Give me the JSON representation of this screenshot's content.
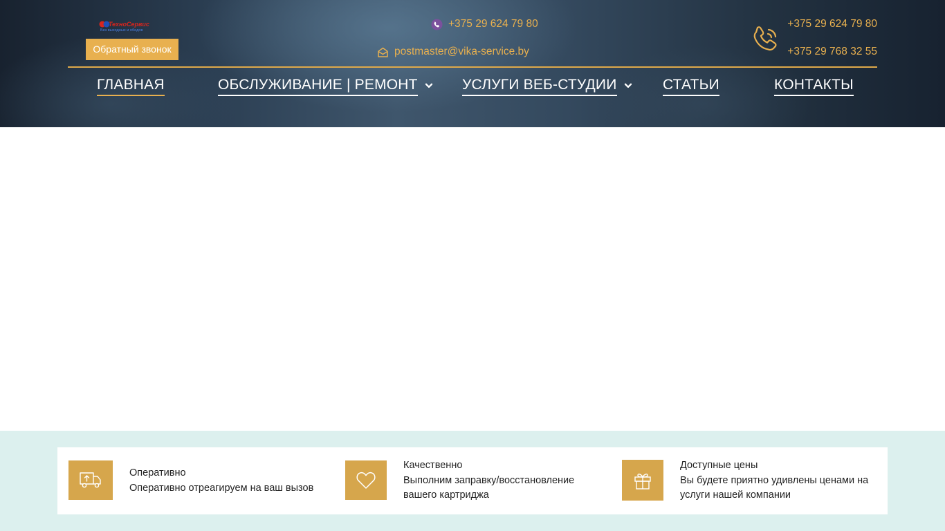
{
  "header": {
    "logo": {
      "text": "ТехноСервис",
      "tagline": "Без выходных и обедов",
      "icon": "logo-icon"
    },
    "callback_button": "Обратный звонок",
    "viber_phone": "+375 29 624 79 80",
    "email": "postmaster@vika-service.by",
    "phones_right": [
      "+375 29 624 79 80",
      "+375 29 768 32 55"
    ],
    "accent_color": "#e8b04f"
  },
  "nav": {
    "items": [
      {
        "label": "ГЛАВНАЯ",
        "active": true,
        "has_dropdown": false
      },
      {
        "label": "ОБСЛУЖИВАНИЕ | РЕМОНТ",
        "active": false,
        "has_dropdown": true
      },
      {
        "label": "УСЛУГИ ВЕБ-СТУДИИ",
        "active": false,
        "has_dropdown": true
      },
      {
        "label": "СТАТЬИ",
        "active": false,
        "has_dropdown": false
      },
      {
        "label": "КОНТАКТЫ",
        "active": false,
        "has_dropdown": false
      }
    ]
  },
  "features": {
    "background_color": "#dcf0ee",
    "icon_color": "#d6a64c",
    "items": [
      {
        "icon": "truck-icon",
        "title": "Оперативно",
        "description": "Оперативно отреагируем на ваш вызов"
      },
      {
        "icon": "heart-icon",
        "title": "Качественно",
        "description_lines": [
          "Выполним заправку/восстановление",
          "вашего картриджа"
        ]
      },
      {
        "icon": "gift-icon",
        "title": "Доступные цены",
        "description_lines": [
          "Вы будете приятно удивлены ценами на",
          "услуги нашей компании"
        ]
      }
    ]
  }
}
